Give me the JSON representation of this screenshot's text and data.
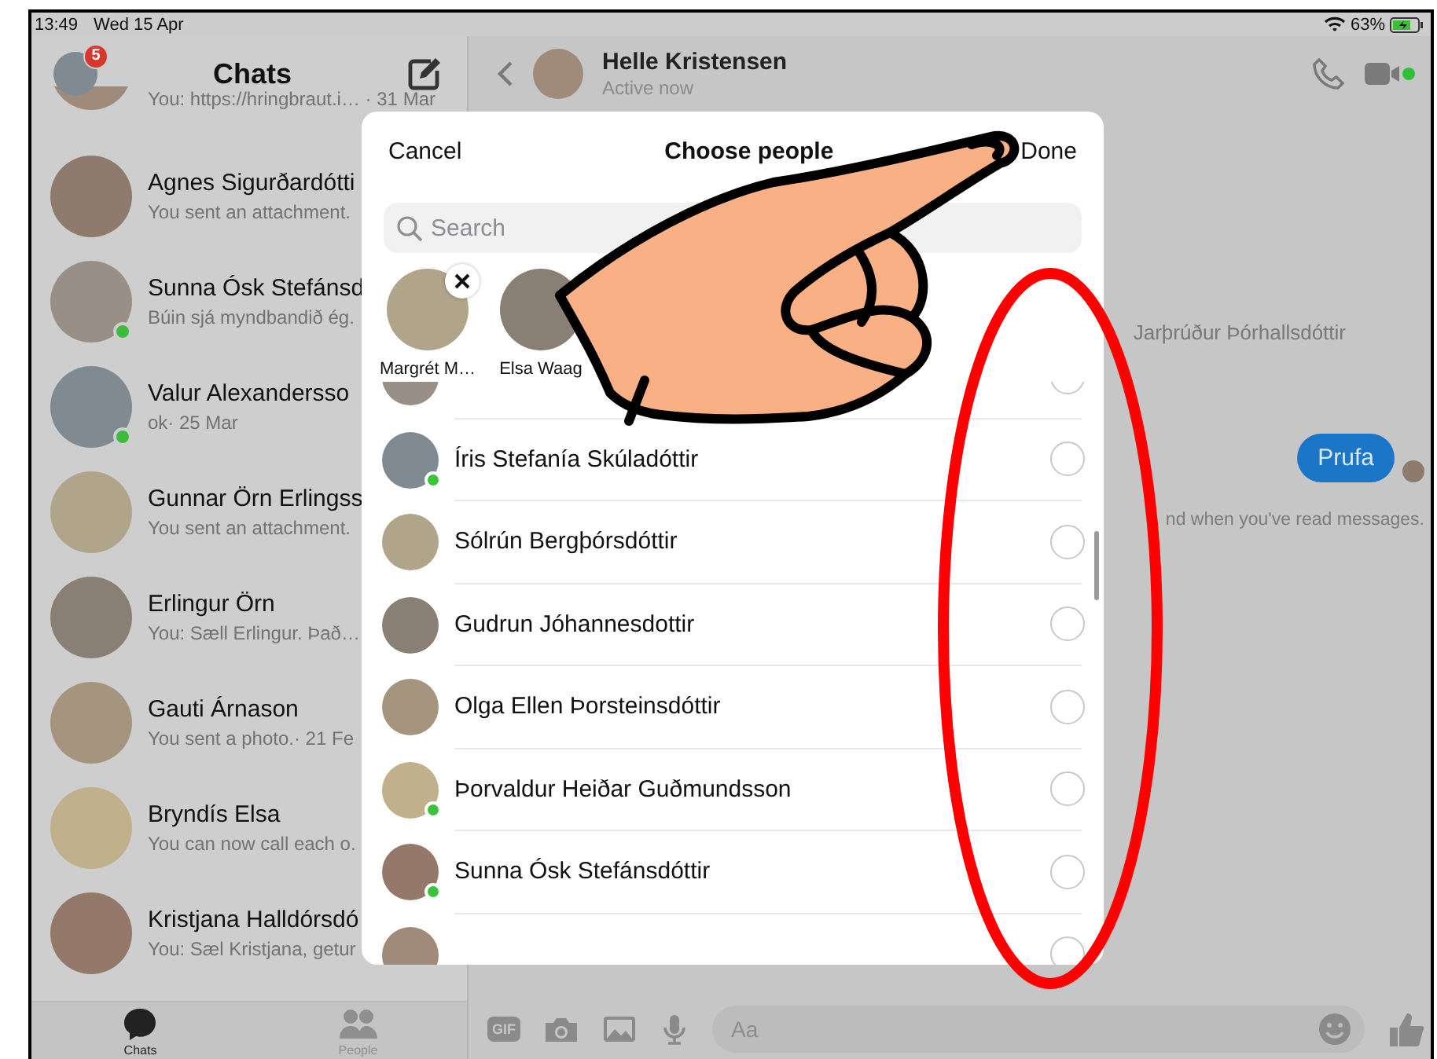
{
  "status_bar": {
    "time": "13:49",
    "date": "Wed 15 Apr",
    "battery": "63%"
  },
  "chats_panel": {
    "title": "Chats",
    "badge": "5",
    "chats": [
      {
        "preview": "You: https://hringbraut.i… · 31 Mar",
        "online": false
      },
      {
        "name": "Agnes Sigurðardótti",
        "preview": "You sent an attachment.",
        "online": false
      },
      {
        "name": "Sunna Ósk Stefánsd",
        "preview": "Búin sjá myndbandið ég.",
        "online": true
      },
      {
        "name": "Valur Alexandersso",
        "preview": "ok· 25 Mar",
        "online": true
      },
      {
        "name": "Gunnar Örn Erlingss",
        "preview": "You sent an attachment.",
        "online": false
      },
      {
        "name": "Erlingur Örn",
        "preview": "You: Sæll Erlingur. Það…",
        "online": false
      },
      {
        "name": "Gauti Árnason",
        "preview": "You sent a photo.· 21 Fe",
        "online": false
      },
      {
        "name": "Bryndís Elsa",
        "preview": "You can now call each o.",
        "online": false
      },
      {
        "name": "Kristjana Halldórsdó",
        "preview": "You: Sæl Kristjana, getur",
        "online": false
      }
    ],
    "tabs": [
      {
        "label": "Chats",
        "selected": true
      },
      {
        "label": "People",
        "selected": false
      }
    ]
  },
  "conversation": {
    "name": "Helle Kristensen",
    "status": "Active now",
    "online": true,
    "messages": [
      {
        "kind": "seen_by",
        "text": "Jarþrúður Þórhallsdóttir"
      },
      {
        "kind": "bubble",
        "text": "Prufa"
      },
      {
        "kind": "note",
        "text": "nd when you've read messages."
      }
    ],
    "composer": {
      "gif": "GIF",
      "placeholder": "Aa"
    }
  },
  "picker": {
    "cancel": "Cancel",
    "title": "Choose people",
    "done": "Done",
    "search": {
      "placeholder": "Search"
    },
    "chosen": [
      {
        "name": "Margrét M…",
        "removable": true
      },
      {
        "name": "Elsa Waag",
        "removable": false
      }
    ],
    "people": [
      {
        "online": false,
        "selected": false
      },
      {
        "name": "Íris Stefanía Skúladóttir",
        "online": true,
        "selected": false
      },
      {
        "name": "Sólrún Bergþórsdóttir",
        "online": false,
        "selected": false
      },
      {
        "name": "Gudrun Jóhannesdottir",
        "online": false,
        "selected": false
      },
      {
        "name": "Olga Ellen Þorsteinsdóttir",
        "online": false,
        "selected": false
      },
      {
        "name": "Þorvaldur Heiðar Guðmundsson",
        "online": true,
        "selected": false
      },
      {
        "name": "Sunna Ósk Stefánsdóttir",
        "online": true,
        "selected": false
      },
      {
        "online": false,
        "selected": false
      }
    ]
  }
}
